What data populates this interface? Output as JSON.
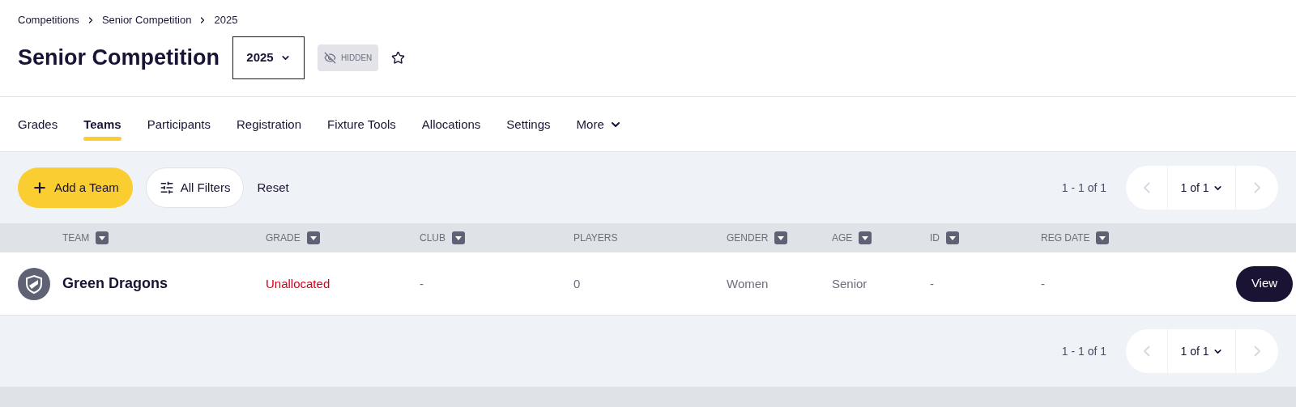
{
  "breadcrumb": [
    "Competitions",
    "Senior Competition",
    "2025"
  ],
  "title": "Senior Competition",
  "season_select": {
    "value": "2025"
  },
  "visibility_badge": {
    "label": "HIDDEN"
  },
  "favourite": {
    "on": false
  },
  "tabs": [
    {
      "label": "Grades",
      "selected": false
    },
    {
      "label": "Teams",
      "selected": true
    },
    {
      "label": "Participants",
      "selected": false
    },
    {
      "label": "Registration",
      "selected": false
    },
    {
      "label": "Fixture Tools",
      "selected": false
    },
    {
      "label": "Allocations",
      "selected": false
    },
    {
      "label": "Settings",
      "selected": false
    },
    {
      "label": "More",
      "selected": false,
      "kind": "dropdown"
    }
  ],
  "toolbar": {
    "add_button": "Add a Team",
    "filters_button": "All Filters",
    "reset_link": "Reset"
  },
  "pagination_top": {
    "range": "1 - 1 of 1",
    "page": "1 of 1"
  },
  "table": {
    "columns": [
      {
        "label": "TEAM",
        "sortable": true
      },
      {
        "label": "GRADE",
        "sortable": true
      },
      {
        "label": "CLUB",
        "sortable": true
      },
      {
        "label": "PLAYERS",
        "sortable": false
      },
      {
        "label": "GENDER",
        "sortable": true
      },
      {
        "label": "AGE",
        "sortable": true
      },
      {
        "label": "ID",
        "sortable": true
      },
      {
        "label": "REG DATE",
        "sortable": true
      }
    ],
    "rows": [
      {
        "cells": [
          "Green Dragons",
          "Unallocated",
          "-",
          "0",
          "Women",
          "Senior",
          "-",
          "-"
        ],
        "grade_unallocated": true,
        "action": "View"
      }
    ]
  },
  "pagination_bottom": {
    "range": "1 - 1 of 1",
    "page": "1 of 1"
  }
}
